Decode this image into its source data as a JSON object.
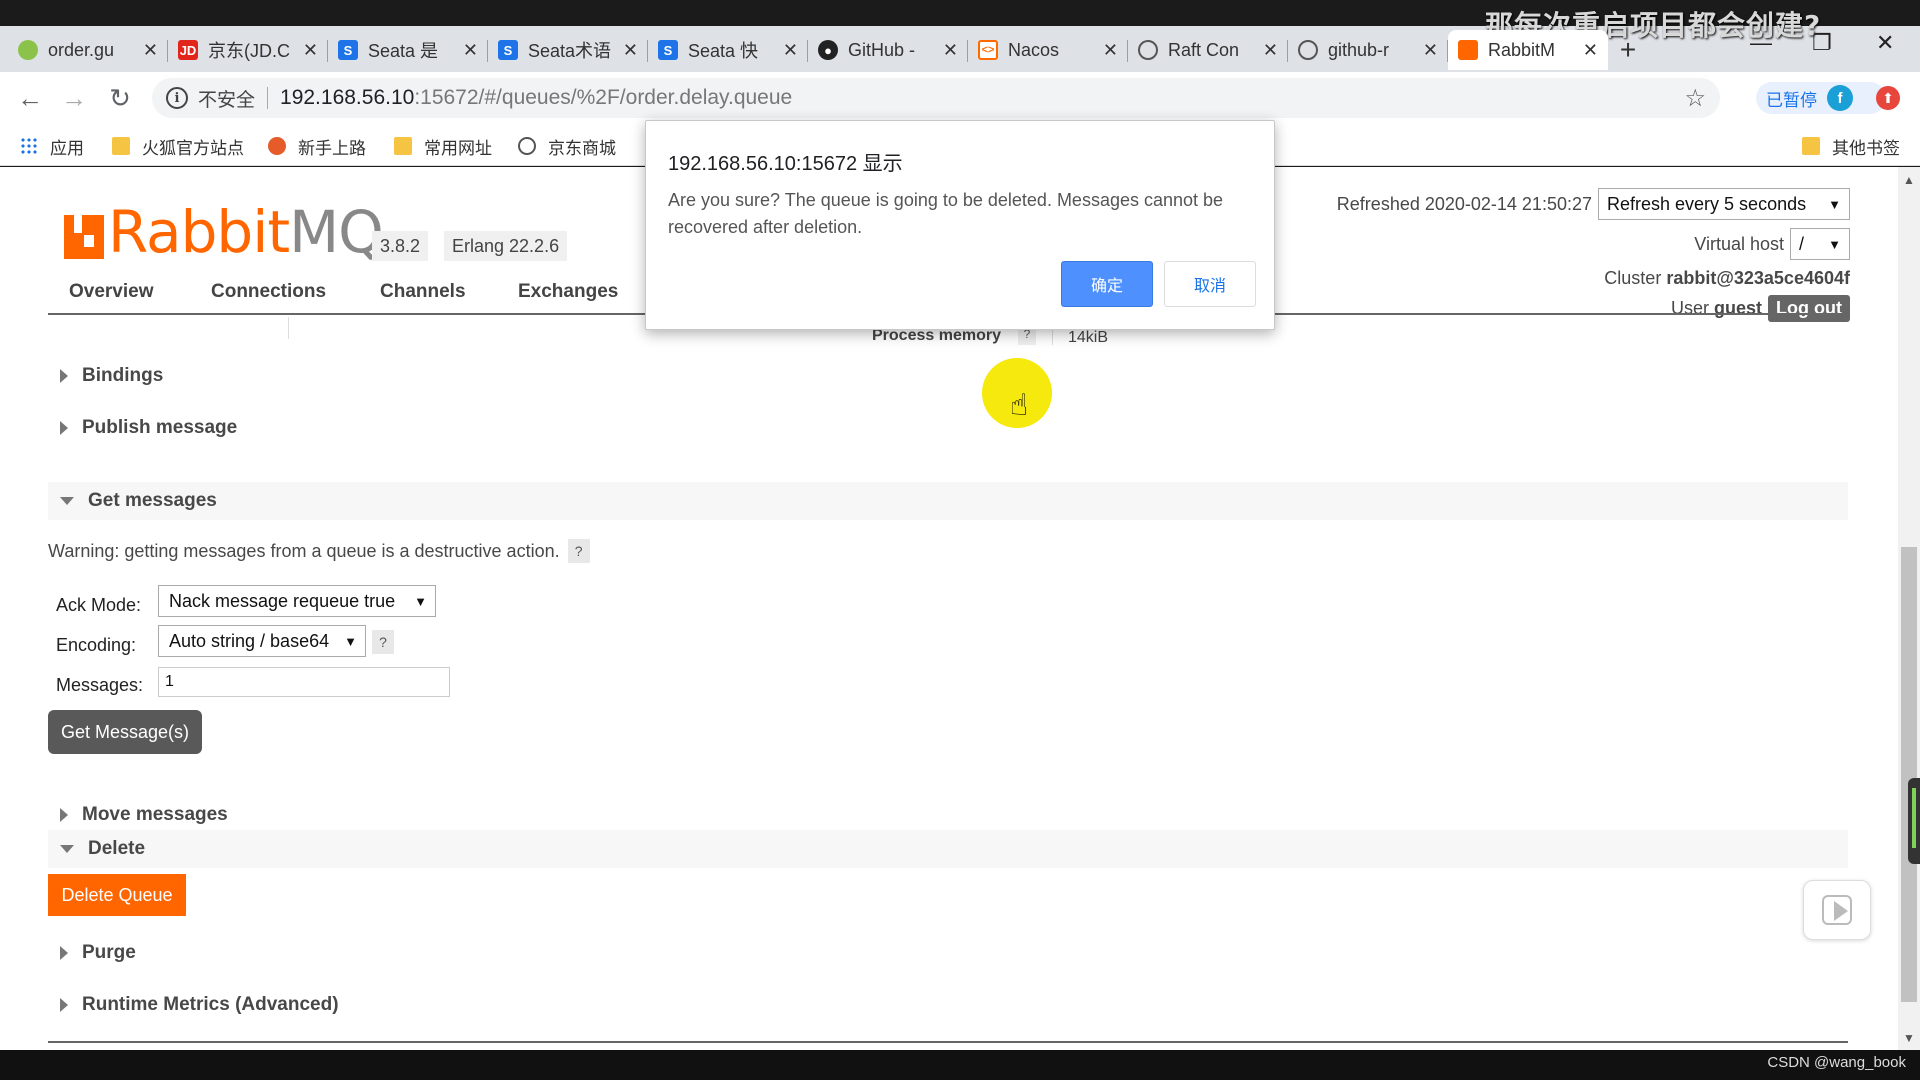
{
  "overlay_caption": "那每次重启项目都会创建?",
  "tabs": [
    {
      "title": "order.gu",
      "icon": "leaf-icon",
      "color": "#8bc34a"
    },
    {
      "title": "京东(JD.C",
      "icon": "jd-icon",
      "color": "#e1251b"
    },
    {
      "title": "Seata 是",
      "icon": "seata-icon",
      "color": "#1e73e8"
    },
    {
      "title": "Seata术语",
      "icon": "seata-icon",
      "color": "#1e73e8"
    },
    {
      "title": "Seata 快",
      "icon": "seata-icon",
      "color": "#1e73e8"
    },
    {
      "title": "GitHub -",
      "icon": "github-icon",
      "color": "#222222"
    },
    {
      "title": "Nacos",
      "icon": "nacos-icon",
      "color": "#ff6a00"
    },
    {
      "title": "Raft Con",
      "icon": "globe-icon",
      "color": "#555555"
    },
    {
      "title": "github-r",
      "icon": "globe-icon",
      "color": "#555555"
    },
    {
      "title": "RabbitM",
      "icon": "rabbitmq-icon",
      "color": "#ff6600",
      "active": true
    }
  ],
  "toolbar": {
    "insecure_label": "不安全",
    "url_host": "192.168.56.10",
    "url_rest": ":15672/#/queues/%2F/order.delay.queue",
    "profile_label": "已暂停",
    "profile_initial": "f"
  },
  "bookmarks": [
    {
      "label": "应用",
      "icon": "apps-grid-icon"
    },
    {
      "label": "火狐官方站点",
      "icon": "folder-icon"
    },
    {
      "label": "新手上路",
      "icon": "firefox-icon"
    },
    {
      "label": "常用网址",
      "icon": "folder-icon"
    },
    {
      "label": "京东商城",
      "icon": "globe-icon"
    },
    {
      "label": "其他书签",
      "icon": "folder-icon"
    }
  ],
  "rabbit": {
    "version": "3.8.2",
    "erlang": "Erlang 22.2.6",
    "refreshed": "Refreshed 2020-02-14 21:50:27",
    "refresh_option": "Refresh every 5 seconds",
    "vhost_label": "Virtual host",
    "vhost_value": "/",
    "cluster_label": "Cluster",
    "cluster_value": "rabbit@323a5ce4604f",
    "user_label": "User",
    "user_value": "guest",
    "logout": "Log out",
    "nav": [
      "Overview",
      "Connections",
      "Channels",
      "Exchanges"
    ],
    "process_memory_label": "Process memory",
    "process_memory_value": "14kiB"
  },
  "sections": {
    "bindings": "Bindings",
    "publish": "Publish message",
    "get": "Get messages",
    "move": "Move messages",
    "delete": "Delete",
    "purge": "Purge",
    "runtime": "Runtime Metrics (Advanced)"
  },
  "get_messages": {
    "warning": "Warning: getting messages from a queue is a destructive action.",
    "ack_label": "Ack Mode:",
    "ack_value": "Nack message requeue true",
    "encoding_label": "Encoding:",
    "encoding_value": "Auto string / base64",
    "messages_label": "Messages:",
    "messages_value": "1",
    "button": "Get Message(s)"
  },
  "delete_button": "Delete Queue",
  "dialog": {
    "title": "192.168.56.10:15672 显示",
    "message": "Are you sure? The queue is going to be deleted. Messages cannot be recovered after deletion.",
    "ok": "确定",
    "cancel": "取消"
  },
  "watermark": "CSDN @wang_book"
}
